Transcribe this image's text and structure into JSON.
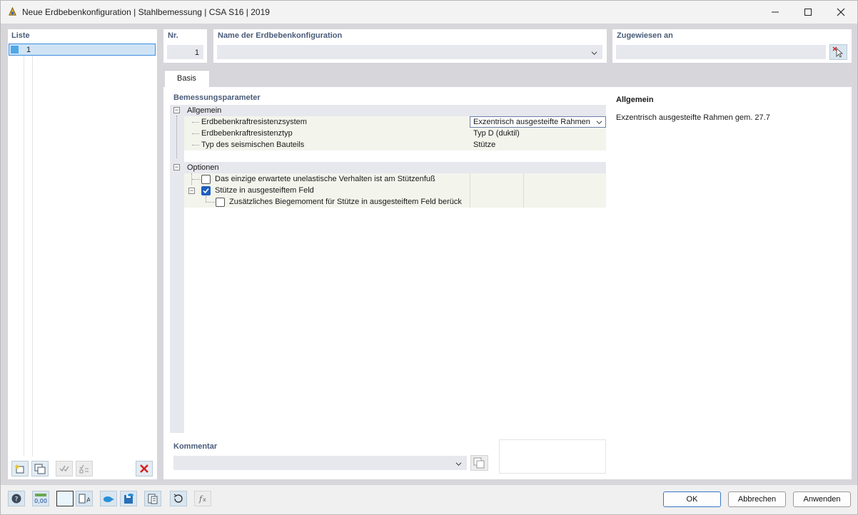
{
  "window": {
    "title": "Neue Erdbebenkonfiguration | Stahlbemessung | CSA S16 | 2019",
    "minimize": "—",
    "maximize": "☐",
    "close": "✕"
  },
  "list": {
    "label": "Liste",
    "items": [
      {
        "number": "1"
      }
    ]
  },
  "nr": {
    "label": "Nr.",
    "value": "1"
  },
  "name": {
    "label": "Name der Erdbebenkonfiguration",
    "value": ""
  },
  "assigned": {
    "label": "Zugewiesen an",
    "value": ""
  },
  "tabs": [
    {
      "label": "Basis"
    }
  ],
  "params": {
    "label": "Bemessungsparameter",
    "allgemein": {
      "label": "Allgemein",
      "rows": [
        {
          "name": "Erdbebenkraftresistenzsystem",
          "value": "Exzentrisch ausgesteifte Rahmen"
        },
        {
          "name": "Erdbebenkraftresistenztyp",
          "value": "Typ D (duktil)"
        },
        {
          "name": "Typ des seismischen Bauteils",
          "value": "Stütze"
        }
      ]
    },
    "optionen": {
      "label": "Optionen",
      "rows": [
        {
          "name": "Das einzige erwartete unelastische Verhalten ist am Stützenfuß",
          "checked": false
        },
        {
          "name": "Stütze in ausgesteiftem Feld",
          "checked": true
        },
        {
          "name": "Zusätzliches Biegemoment für Stütze in ausgesteiftem Feld berück",
          "checked": false
        }
      ]
    }
  },
  "info": {
    "title": "Allgemein",
    "text": "Exzentrisch ausgesteifte Rahmen gem. 27.7"
  },
  "comment": {
    "label": "Kommentar",
    "value": ""
  },
  "buttons": {
    "ok": "OK",
    "cancel": "Abbrechen",
    "apply": "Anwenden"
  },
  "colors": {
    "accent": "#1f5fbf",
    "label": "#4a5c7a",
    "delete": "#d62020"
  }
}
